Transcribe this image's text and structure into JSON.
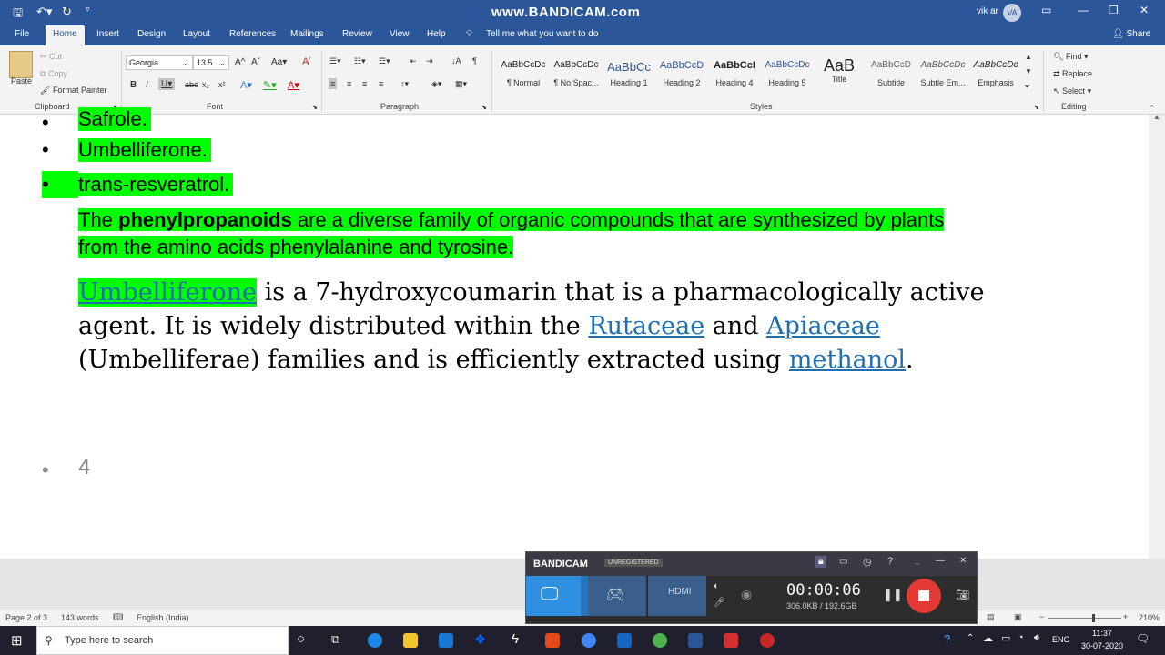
{
  "watermark": "www.BANDICAM.com",
  "user": {
    "name": "vik ar",
    "initials": "VA"
  },
  "tabs": [
    "File",
    "Home",
    "Insert",
    "Design",
    "Layout",
    "References",
    "Mailings",
    "Review",
    "View",
    "Help"
  ],
  "tell_me": "Tell me what you want to do",
  "share": "Share",
  "clipboard": {
    "paste": "Paste",
    "cut": "Cut",
    "copy": "Copy",
    "format_painter": "Format Painter",
    "label": "Clipboard"
  },
  "font": {
    "name": "Georgia",
    "size": "13.5",
    "label": "Font"
  },
  "paragraph_label": "Paragraph",
  "styles": {
    "label": "Styles",
    "items": [
      {
        "preview": "AaBbCcDc",
        "name": "¶ Normal"
      },
      {
        "preview": "AaBbCcDc",
        "name": "¶ No Spac..."
      },
      {
        "preview": "AaBbCc",
        "name": "Heading 1"
      },
      {
        "preview": "AaBbCcD",
        "name": "Heading 2"
      },
      {
        "preview": "AaBbCcI",
        "name": "Heading 4"
      },
      {
        "preview": "AaBbCcDc",
        "name": "Heading 5"
      },
      {
        "preview": "AaB",
        "name": "Title"
      },
      {
        "preview": "AaBbCcD",
        "name": "Subtitle"
      },
      {
        "preview": "AaBbCcDc",
        "name": "Subtle Em..."
      },
      {
        "preview": "AaBbCcDc",
        "name": "Emphasis"
      }
    ]
  },
  "editing": {
    "find": "Find",
    "replace": "Replace",
    "select": "Select",
    "label": "Editing"
  },
  "doc": {
    "list_items": [
      "Safrole.",
      "Umbelliferone.",
      "trans-resveratrol."
    ],
    "p1_a": "The ",
    "p1_b": "phenylpropanoids",
    "p1_c": " are a diverse family of organic compounds that are synthesized by plants from the amino acids phenylalanine and tyrosine.",
    "p2_link1": "Umbelliferone",
    "p2_a": " is a 7-hydroxycoumarin that is a pharmacologically active agent. It is widely distributed within the ",
    "p2_link2": "Rutaceae",
    "p2_b": " and ",
    "p2_link3": "Apiaceae",
    "p2_c": " (Umbelliferae) families and is efficiently extracted using ",
    "p2_link4": "methanol",
    "p2_d": ".",
    "bullet_num": "4"
  },
  "status": {
    "page": "Page 2 of 3",
    "words": "143 words",
    "lang": "English (India)",
    "zoom": "210%"
  },
  "bandicam": {
    "brand": "BANDICAM",
    "reg": "UNREGISTERED",
    "timer": "00:00:06",
    "size": "306.0KB / 192.6GB"
  },
  "taskbar": {
    "search": "Type here to search",
    "lang": "ENG",
    "time": "11:37",
    "date": "30-07-2020"
  }
}
